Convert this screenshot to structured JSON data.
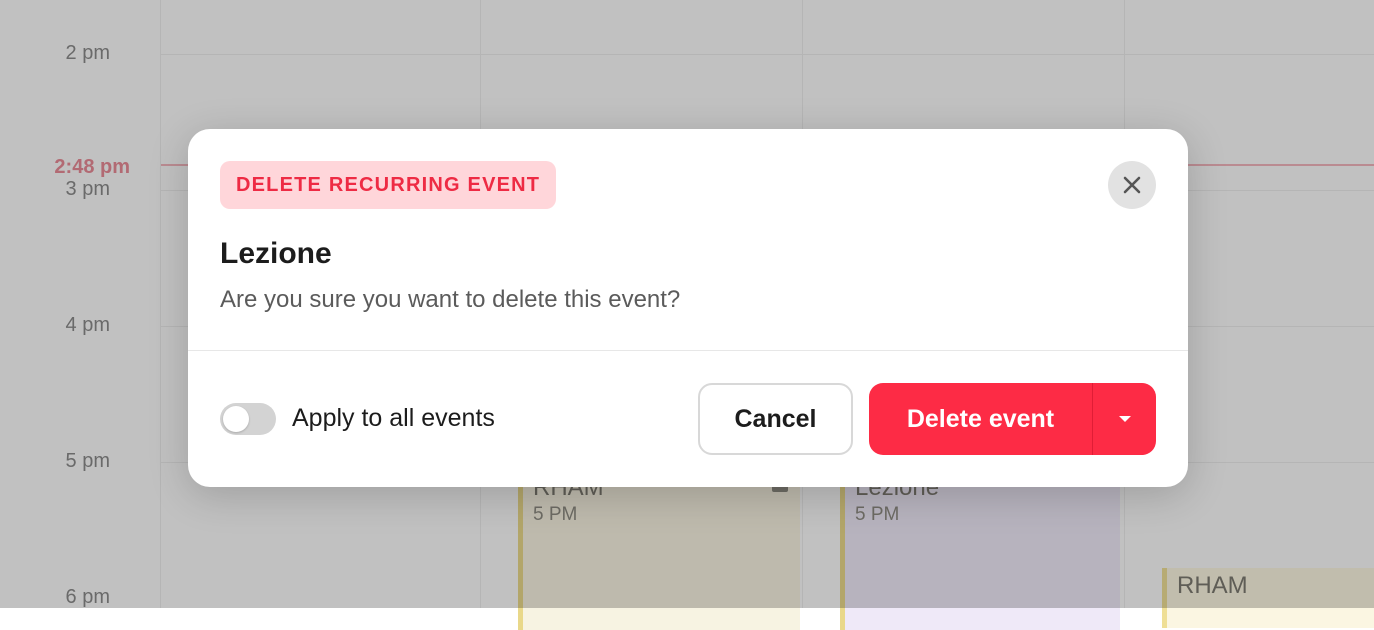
{
  "calendar": {
    "time_labels": [
      "2 pm",
      "3 pm",
      "4 pm",
      "5 pm",
      "6 pm"
    ],
    "current_time": "2:48 pm",
    "events": [
      {
        "title": "RHAM",
        "time": "5 PM"
      },
      {
        "title": "Lezione",
        "time": "5 PM"
      },
      {
        "title": "RHAM"
      }
    ]
  },
  "modal": {
    "badge": "DELETE RECURRING EVENT",
    "title": "Lezione",
    "message": "Are you sure you want to delete this event?",
    "toggle": {
      "label": "Apply to all events",
      "checked": false
    },
    "cancel_label": "Cancel",
    "delete_label": "Delete event",
    "close_icon": "close-icon",
    "dropdown_icon": "caret-down-icon"
  },
  "colors": {
    "accent": "#fd2b45",
    "badge_bg": "#ffd6da",
    "badge_text": "#ee2b44"
  }
}
